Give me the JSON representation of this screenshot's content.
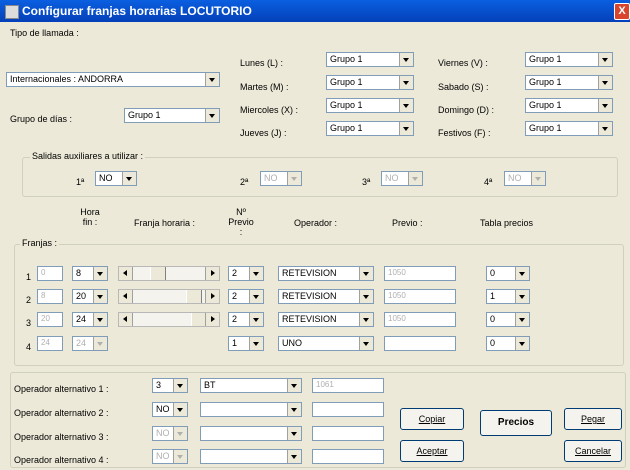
{
  "window": {
    "title": "Configurar franjas horarias LOCUTORIO",
    "close_label": "X"
  },
  "tipo": {
    "label": "Tipo de llamada :",
    "value": "Internacionales : ANDORRA",
    "grupo_dias_label": "Grupo de días :",
    "grupo_dias_value": "Grupo 1"
  },
  "days": [
    {
      "label": "Lunes (L) :",
      "value": "Grupo 1"
    },
    {
      "label": "Martes (M) :",
      "value": "Grupo 1"
    },
    {
      "label": "Miercoles (X) :",
      "value": "Grupo 1"
    },
    {
      "label": "Jueves (J) :",
      "value": "Grupo 1"
    },
    {
      "label": "Viernes (V) :",
      "value": "Grupo 1"
    },
    {
      "label": "Sabado (S) :",
      "value": "Grupo 1"
    },
    {
      "label": "Domingo (D) :",
      "value": "Grupo 1"
    },
    {
      "label": "Festivos (F) :",
      "value": "Grupo 1"
    }
  ],
  "salidas": {
    "label": "Salidas auxiliares a utilizar :",
    "items": [
      {
        "label": "1ª",
        "value": "NO"
      },
      {
        "label": "2ª",
        "value": "NO"
      },
      {
        "label": "3ª",
        "value": "NO"
      },
      {
        "label": "4ª",
        "value": "NO"
      }
    ]
  },
  "franjas_headers": {
    "hora_fin": "Hora fin :",
    "franja": "Franja horaria :",
    "n_previo": "Nº Previo :",
    "operador": "Operador :",
    "previo": "Previo :",
    "tabla": "Tabla precios",
    "franjas": "Franjas :"
  },
  "franjas_rows": [
    {
      "num": "1",
      "start": "0",
      "end": "8",
      "n": "2",
      "op": "RETEVISION",
      "previo": "1050",
      "tabla": "0",
      "thumb": 0.3
    },
    {
      "num": "2",
      "start": "8",
      "end": "20",
      "n": "2",
      "op": "RETEVISION",
      "previo": "1050",
      "tabla": "1",
      "thumb": 0.92
    },
    {
      "num": "3",
      "start": "20",
      "end": "24",
      "n": "2",
      "op": "RETEVISION",
      "previo": "1050",
      "tabla": "0",
      "thumb": 1.0
    },
    {
      "num": "4",
      "start": "24",
      "end": "24",
      "n": "1",
      "op": "UNO",
      "previo": "",
      "tabla": "0"
    }
  ],
  "alternativos": [
    {
      "label": "Operador alternativo 1 :",
      "n": "3",
      "op": "BT",
      "code": "1061"
    },
    {
      "label": "Operador alternativo 2 :",
      "n": "NO",
      "op": "",
      "code": ""
    },
    {
      "label": "Operador alternativo 3 :",
      "n": "NO",
      "op": "",
      "code": ""
    },
    {
      "label": "Operador alternativo 4 :",
      "n": "NO",
      "op": "",
      "code": ""
    }
  ],
  "buttons": {
    "copiar": "Copiar",
    "precios": "Precios",
    "pegar": "Pegar",
    "aceptar": "Aceptar",
    "cancelar": "Cancelar"
  }
}
